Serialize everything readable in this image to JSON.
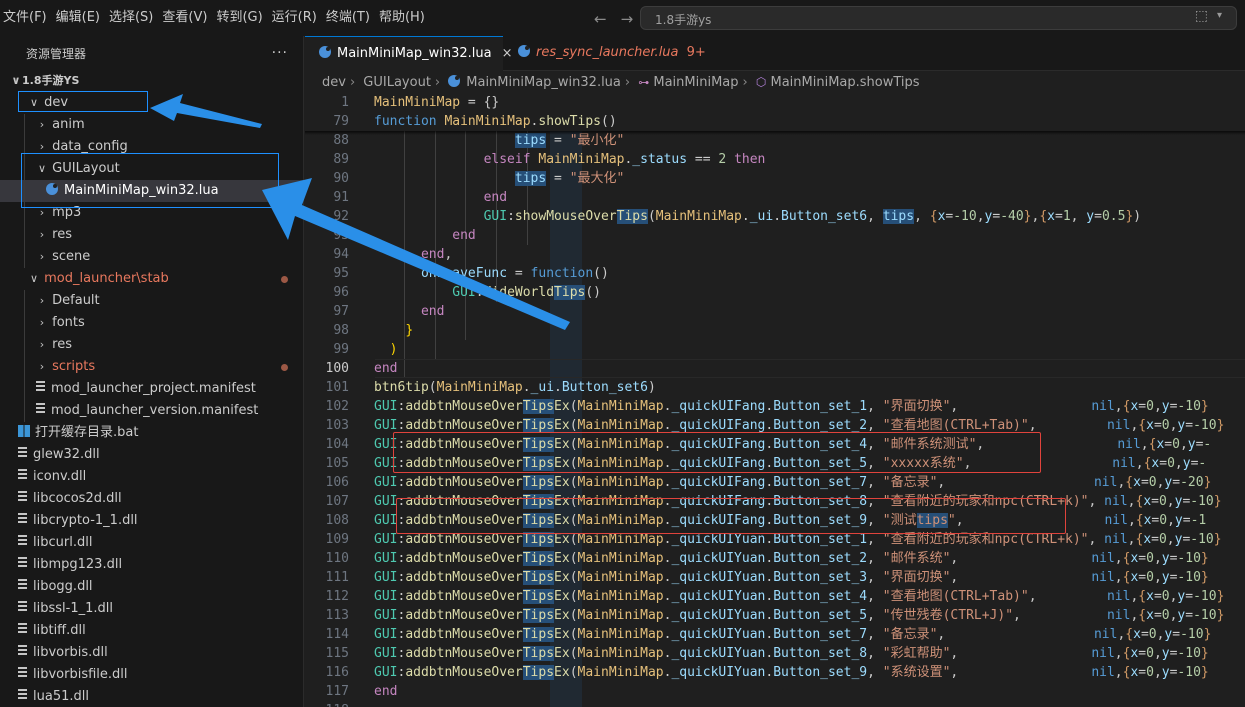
{
  "menu": [
    "文件(F)",
    "编辑(E)",
    "选择(S)",
    "查看(V)",
    "转到(G)",
    "运行(R)",
    "终端(T)",
    "帮助(H)"
  ],
  "nav": {
    "back": "←",
    "forward": "→"
  },
  "search": {
    "text": "1.8手游ys"
  },
  "sidebar": {
    "title": "资源管理器",
    "more": "···",
    "root": "1.8手游YS",
    "items": [
      {
        "label": "dev",
        "type": "folder-open",
        "level": 1
      },
      {
        "label": "anim",
        "type": "folder",
        "level": 2
      },
      {
        "label": "data_config",
        "type": "folder",
        "level": 2
      },
      {
        "label": "GUILayout",
        "type": "folder-open",
        "level": 2
      },
      {
        "label": "MainMiniMap_win32.lua",
        "type": "lua",
        "level": 3,
        "selected": true
      },
      {
        "label": "mp3",
        "type": "folder",
        "level": 2
      },
      {
        "label": "res",
        "type": "folder",
        "level": 2
      },
      {
        "label": "scene",
        "type": "folder",
        "level": 2
      },
      {
        "label": "mod_launcher\\stab",
        "type": "folder-open",
        "level": 1,
        "modified": true
      },
      {
        "label": "Default",
        "type": "folder",
        "level": 2
      },
      {
        "label": "fonts",
        "type": "folder",
        "level": 2
      },
      {
        "label": "res",
        "type": "folder",
        "level": 2
      },
      {
        "label": "scripts",
        "type": "folder",
        "level": 2,
        "modified": true
      },
      {
        "label": "mod_launcher_project.manifest",
        "type": "file",
        "level": 2
      },
      {
        "label": "mod_launcher_version.manifest",
        "type": "file",
        "level": 2
      },
      {
        "label": "打开缓存目录.bat",
        "type": "bat",
        "level": 0
      },
      {
        "label": "glew32.dll",
        "type": "dll",
        "level": 0
      },
      {
        "label": "iconv.dll",
        "type": "dll",
        "level": 0
      },
      {
        "label": "libcocos2d.dll",
        "type": "dll",
        "level": 0
      },
      {
        "label": "libcrypto-1_1.dll",
        "type": "dll",
        "level": 0
      },
      {
        "label": "libcurl.dll",
        "type": "dll",
        "level": 0
      },
      {
        "label": "libmpg123.dll",
        "type": "dll",
        "level": 0
      },
      {
        "label": "libogg.dll",
        "type": "dll",
        "level": 0
      },
      {
        "label": "libssl-1_1.dll",
        "type": "dll",
        "level": 0
      },
      {
        "label": "libtiff.dll",
        "type": "dll",
        "level": 0
      },
      {
        "label": "libvorbis.dll",
        "type": "dll",
        "level": 0
      },
      {
        "label": "libvorbisfile.dll",
        "type": "dll",
        "level": 0
      },
      {
        "label": "lua51.dll",
        "type": "dll",
        "level": 0
      }
    ]
  },
  "tabs": [
    {
      "label": "MainMiniMap_win32.lua",
      "close": "×",
      "active": true
    },
    {
      "label": "res_sync_launcher.lua",
      "badge": "9+",
      "active": false
    }
  ],
  "breadcrumb": [
    "dev",
    "GUILayout",
    "MainMiniMap_win32.lua",
    "MainMiniMap",
    "MainMiniMap.showTips"
  ],
  "editor": {
    "sticky": [
      {
        "ln": "1",
        "html": "<span class='y'>MainMiniMap</span> = {}"
      },
      {
        "ln": "79",
        "html": "<span class='kw'>function</span> <span class='y'>MainMiniMap</span>.<span class='fn'>showTips</span>()"
      }
    ],
    "current_line": "100",
    "lines": [
      {
        "ln": "88",
        "html": "                  <span class='v hl'>tips</span> = <span class='s'>\"最小化\"</span>"
      },
      {
        "ln": "89",
        "html": "              <span class='k'>elseif</span> <span class='y'>MainMiniMap</span>.<span class='v'>_status</span> == <span class='n'>2</span> <span class='k'>then</span>"
      },
      {
        "ln": "90",
        "html": "                  <span class='v hl'>tips</span> = <span class='s'>\"最大化\"</span>"
      },
      {
        "ln": "91",
        "html": "              <span class='k'>end</span>"
      },
      {
        "ln": "92",
        "html": "              <span class='gl'>GUI</span>:<span class='fn'>showMouseOver<span class='hl'>Tips</span></span>(<span class='y'>MainMiniMap</span>.<span class='v'>_ui</span>.<span class='v'>Button_set6</span>, <span class='v hl'>tips</span>, <span class='o'>{</span><span class='v'>x</span>=<span class='n'>-10</span>,<span class='v'>y</span>=<span class='n'>-40</span><span class='o'>}</span>,<span class='o'>{</span><span class='v'>x</span>=<span class='n'>1</span>, <span class='v'>y</span>=<span class='n'>0.5</span><span class='o'>}</span>)"
      },
      {
        "ln": "93",
        "html": "          <span class='k'>end</span>"
      },
      {
        "ln": "94",
        "html": "      <span class='k'>end</span>,"
      },
      {
        "ln": "95",
        "html": "      <span class='v'>onLeaveFunc</span> = <span class='kw'>function</span>()"
      },
      {
        "ln": "96",
        "html": "          <span class='gl'>GUI</span>:<span class='fn'>HideWorld<span class='hl'>Tips</span></span>()"
      },
      {
        "ln": "97",
        "html": "      <span class='k'>end</span>"
      },
      {
        "ln": "98",
        "html": "    <span class='p'>}</span>"
      },
      {
        "ln": "99",
        "html": "  <span class='p'>)</span>"
      },
      {
        "ln": "100",
        "html": "<span class='k'>end</span>"
      },
      {
        "ln": "101",
        "html": "<span class='fn'>btn6tip</span>(<span class='y'>MainMiniMap</span>.<span class='v'>_ui</span>.<span class='v'>Button_set6</span>)"
      },
      {
        "ln": "102",
        "html": "<span class='gl'>GUI</span>:<span class='fn'>addbtnMouseOver<span class='hl'>Tips</span>Ex</span>(<span class='y'>MainMiniMap</span>.<span class='v'>_quickUIFang</span>.<span class='v'>Button_set_1</span>, <span class='s'>\"界面切换\"</span>,                 <span class='kw'>nil</span>,<span class='o'>{</span><span class='v'>x</span>=<span class='n'>0</span>,<span class='v'>y</span>=<span class='n'>-10</span><span class='o'>}</span>"
      },
      {
        "ln": "103",
        "html": "<span class='gl'>GUI</span>:<span class='fn'>addbtnMouseOver<span class='hl'>Tips</span>Ex</span>(<span class='y'>MainMiniMap</span>.<span class='v'>_quickUIFang</span>.<span class='v'>Button_set_2</span>, <span class='s'>\"查看地图(CTRL+Tab)\"</span>,         <span class='kw'>nil</span>,<span class='o'>{</span><span class='v'>x</span>=<span class='n'>0</span>,<span class='v'>y</span>=<span class='n'>-10</span><span class='o'>}</span>"
      },
      {
        "ln": "104",
        "html": "<span class='gl'>GUI</span>:<span class='fn'>addbtnMouseOver<span class='hl'>Tips</span>Ex</span>(<span class='y'>MainMiniMap</span>.<span class='v'>_quickUIFang</span>.<span class='v'>Button_set_4</span>, <span class='s'>\"邮件系统测试\"</span>,                 <span class='kw'>nil</span>,<span class='o'>{</span><span class='v'>x</span>=<span class='n'>0</span>,<span class='v'>y</span>=<span class='n'>-</span>"
      },
      {
        "ln": "105",
        "html": "<span class='gl'>GUI</span>:<span class='fn'>addbtnMouseOver<span class='hl'>Tips</span>Ex</span>(<span class='y'>MainMiniMap</span>.<span class='v'>_quickUIFang</span>.<span class='v'>Button_set_5</span>, <span class='s'>\"xxxxx系统\"</span>,                  <span class='kw'>nil</span>,<span class='o'>{</span><span class='v'>x</span>=<span class='n'>0</span>,<span class='v'>y</span>=<span class='n'>-</span>"
      },
      {
        "ln": "106",
        "html": "<span class='gl'>GUI</span>:<span class='fn'>addbtnMouseOver<span class='hl'>Tips</span>Ex</span>(<span class='y'>MainMiniMap</span>.<span class='v'>_quickUIFang</span>.<span class='v'>Button_set_7</span>, <span class='s'>\"备忘录\"</span>,                   <span class='kw'>nil</span>,<span class='o'>{</span><span class='v'>x</span>=<span class='n'>0</span>,<span class='v'>y</span>=<span class='n'>-20</span><span class='o'>}</span>"
      },
      {
        "ln": "107",
        "html": "<span class='gl'>GUI</span>:<span class='fn'>addbtnMouseOver<span class='hl'>Tips</span>Ex</span>(<span class='y'>MainMiniMap</span>.<span class='v'>_quickUIFang</span>.<span class='v'>Button_set_8</span>, <span class='s'>\"查看附近的玩家和npc(CTRL+k)\"</span>, <span class='kw'>nil</span>,<span class='o'>{</span><span class='v'>x</span>=<span class='n'>0</span>,<span class='v'>y</span>=<span class='n'>-10</span><span class='o'>}</span>"
      },
      {
        "ln": "108",
        "html": "<span class='gl'>GUI</span>:<span class='fn'>addbtnMouseOver<span class='hl'>Tips</span>Ex</span>(<span class='y'>MainMiniMap</span>.<span class='v'>_quickUIFang</span>.<span class='v'>Button_set_9</span>, <span class='s'>\"测试<span class='hl'>tips</span>\"</span>,                  <span class='kw'>nil</span>,<span class='o'>{</span><span class='v'>x</span>=<span class='n'>0</span>,<span class='v'>y</span>=<span class='n'>-1</span>"
      },
      {
        "ln": "109",
        "html": "<span class='gl'>GUI</span>:<span class='fn'>addbtnMouseOver<span class='hl'>Tips</span>Ex</span>(<span class='y'>MainMiniMap</span>.<span class='v'>_quickUIYuan</span>.<span class='v'>Button_set_1</span>, <span class='s'>\"查看附近的玩家和npc(CTRL+k)\"</span>, <span class='kw'>nil</span>,<span class='o'>{</span><span class='v'>x</span>=<span class='n'>0</span>,<span class='v'>y</span>=<span class='n'>-10</span><span class='o'>}</span>"
      },
      {
        "ln": "110",
        "html": "<span class='gl'>GUI</span>:<span class='fn'>addbtnMouseOver<span class='hl'>Tips</span>Ex</span>(<span class='y'>MainMiniMap</span>.<span class='v'>_quickUIYuan</span>.<span class='v'>Button_set_2</span>, <span class='s'>\"邮件系统\"</span>,                 <span class='kw'>nil</span>,<span class='o'>{</span><span class='v'>x</span>=<span class='n'>0</span>,<span class='v'>y</span>=<span class='n'>-10</span><span class='o'>}</span>"
      },
      {
        "ln": "111",
        "html": "<span class='gl'>GUI</span>:<span class='fn'>addbtnMouseOver<span class='hl'>Tips</span>Ex</span>(<span class='y'>MainMiniMap</span>.<span class='v'>_quickUIYuan</span>.<span class='v'>Button_set_3</span>, <span class='s'>\"界面切换\"</span>,                 <span class='kw'>nil</span>,<span class='o'>{</span><span class='v'>x</span>=<span class='n'>0</span>,<span class='v'>y</span>=<span class='n'>-10</span><span class='o'>}</span>"
      },
      {
        "ln": "112",
        "html": "<span class='gl'>GUI</span>:<span class='fn'>addbtnMouseOver<span class='hl'>Tips</span>Ex</span>(<span class='y'>MainMiniMap</span>.<span class='v'>_quickUIYuan</span>.<span class='v'>Button_set_4</span>, <span class='s'>\"查看地图(CTRL+Tab)\"</span>,         <span class='kw'>nil</span>,<span class='o'>{</span><span class='v'>x</span>=<span class='n'>0</span>,<span class='v'>y</span>=<span class='n'>-10</span><span class='o'>}</span>"
      },
      {
        "ln": "113",
        "html": "<span class='gl'>GUI</span>:<span class='fn'>addbtnMouseOver<span class='hl'>Tips</span>Ex</span>(<span class='y'>MainMiniMap</span>.<span class='v'>_quickUIYuan</span>.<span class='v'>Button_set_5</span>, <span class='s'>\"传世残卷(CTRL+J)\"</span>,           <span class='kw'>nil</span>,<span class='o'>{</span><span class='v'>x</span>=<span class='n'>0</span>,<span class='v'>y</span>=<span class='n'>-10</span><span class='o'>}</span>"
      },
      {
        "ln": "114",
        "html": "<span class='gl'>GUI</span>:<span class='fn'>addbtnMouseOver<span class='hl'>Tips</span>Ex</span>(<span class='y'>MainMiniMap</span>.<span class='v'>_quickUIYuan</span>.<span class='v'>Button_set_7</span>, <span class='s'>\"备忘录\"</span>,                   <span class='kw'>nil</span>,<span class='o'>{</span><span class='v'>x</span>=<span class='n'>0</span>,<span class='v'>y</span>=<span class='n'>-10</span><span class='o'>}</span>"
      },
      {
        "ln": "115",
        "html": "<span class='gl'>GUI</span>:<span class='fn'>addbtnMouseOver<span class='hl'>Tips</span>Ex</span>(<span class='y'>MainMiniMap</span>.<span class='v'>_quickUIYuan</span>.<span class='v'>Button_set_8</span>, <span class='s'>\"彩虹帮助\"</span>,                 <span class='kw'>nil</span>,<span class='o'>{</span><span class='v'>x</span>=<span class='n'>0</span>,<span class='v'>y</span>=<span class='n'>-10</span><span class='o'>}</span>"
      },
      {
        "ln": "116",
        "html": "<span class='gl'>GUI</span>:<span class='fn'>addbtnMouseOver<span class='hl'>Tips</span>Ex</span>(<span class='y'>MainMiniMap</span>.<span class='v'>_quickUIYuan</span>.<span class='v'>Button_set_9</span>, <span class='s'>\"系统设置\"</span>,                 <span class='kw'>nil</span>,<span class='o'>{</span><span class='v'>x</span>=<span class='n'>0</span>,<span class='v'>y</span>=<span class='n'>-10</span><span class='o'>}</span>"
      },
      {
        "ln": "117",
        "html": "<span class='k'>end</span>"
      },
      {
        "ln": "118",
        "html": ""
      }
    ]
  },
  "colors": {
    "accent": "#0078d4",
    "annotation_red": "#e0433c",
    "annotation_blue": "#1e90ff"
  }
}
